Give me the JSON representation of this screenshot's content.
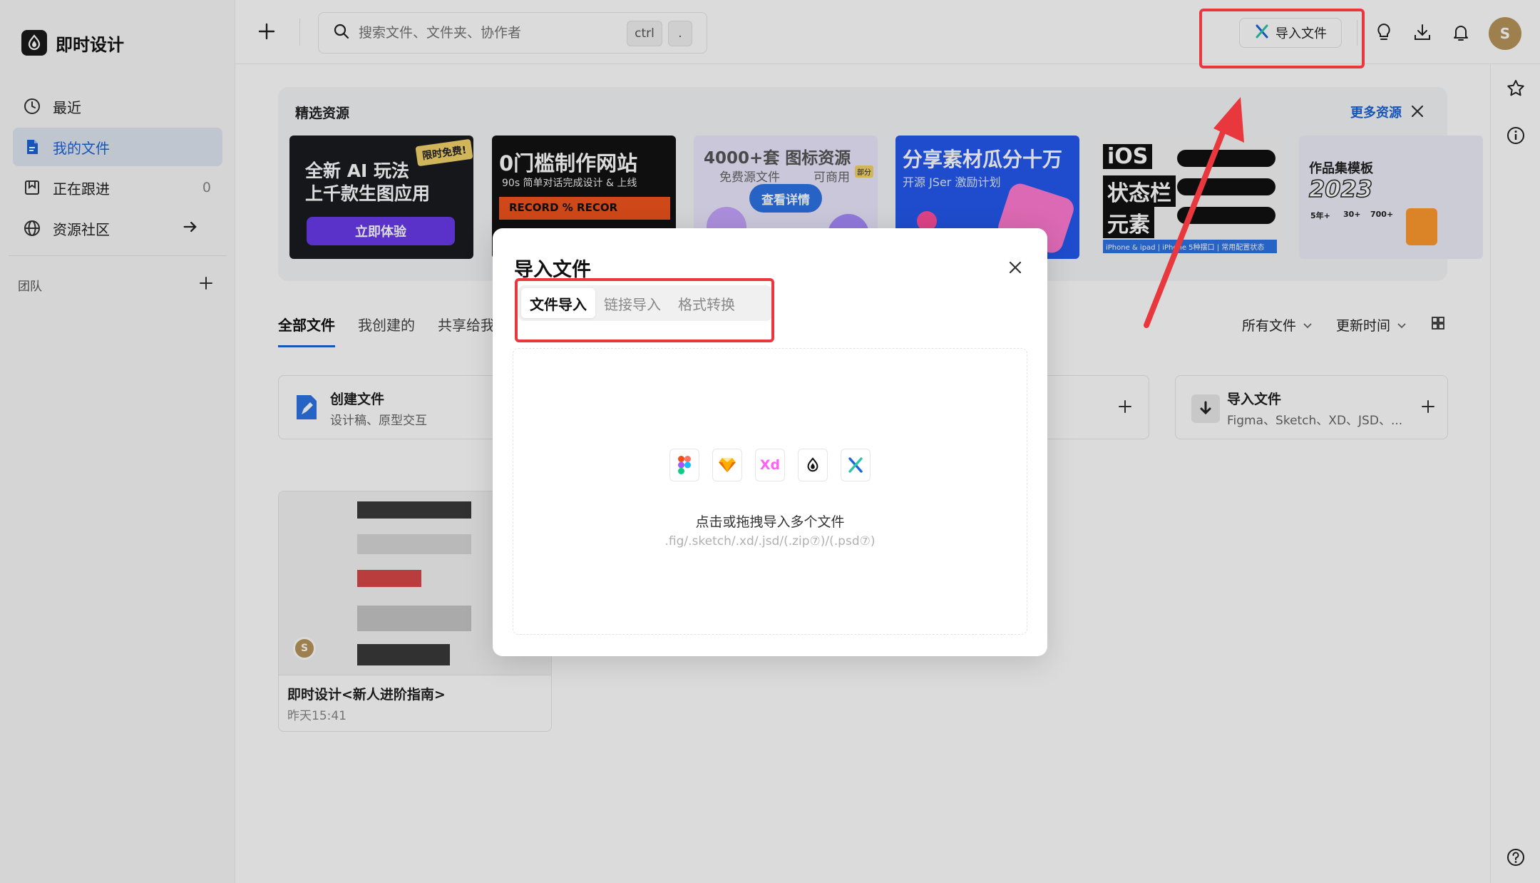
{
  "app": {
    "name": "即时设计"
  },
  "sidebar": {
    "items": [
      {
        "label": "最近",
        "icon": "clock-icon"
      },
      {
        "label": "我的文件",
        "icon": "document-icon",
        "active": true
      },
      {
        "label": "正在跟进",
        "icon": "bookmark-icon",
        "count": "0"
      },
      {
        "label": "资源社区",
        "icon": "globe-icon"
      }
    ],
    "team_label": "团队"
  },
  "search": {
    "placeholder": "搜索文件、文件夹、协作者",
    "shortcut_1": "ctrl",
    "shortcut_2": "."
  },
  "topbar": {
    "import_label": "导入文件",
    "avatar_initial": "S"
  },
  "featured": {
    "title": "精选资源",
    "more_label": "更多资源",
    "cards": [
      {
        "line1": "全新 AI 玩法",
        "line2": "上千款生图应用",
        "badge": "限时免费!",
        "cta": "立即体验"
      },
      {
        "line1": "0门槛制作网站",
        "line2": "90s 简单对话完成设计 & 上线",
        "line3": "RECORD % RECOR"
      },
      {
        "line1": "4000+套 图标资源",
        "line2": "免费源文件",
        "line3": "可商用",
        "badge": "部分",
        "cta": "查看详情"
      },
      {
        "line1": "分享素材瓜分十万",
        "line2": "开源 JSer 激励计划"
      },
      {
        "line1": "iOS",
        "line2": "状态栏",
        "line3": "元素",
        "line4": "iPhone & ipad | iPhone 5种摆口 | 常用配置状态"
      },
      {
        "line1": "作品集模板",
        "line2": "2023",
        "stats": [
          "5年+",
          "30+",
          "700+"
        ]
      }
    ]
  },
  "tabs": {
    "all": "全部文件",
    "created": "我创建的",
    "shared": "共享给我",
    "filter": "所有文件",
    "sort": "更新时间"
  },
  "quick": {
    "create_title": "创建文件",
    "create_sub": "设计稿、原型交互",
    "import_title": "导入文件",
    "import_sub": "Figma、Sketch、XD、JSD、..."
  },
  "file": {
    "name": "即时设计<新人进阶指南>",
    "time": "昨天15:41",
    "avatar_initial": "S"
  },
  "modal": {
    "title": "导入文件",
    "tabs": [
      "文件导入",
      "链接导入",
      "格式转换"
    ],
    "formats": [
      "figma-icon",
      "sketch-icon",
      "xd-icon",
      "jsd-icon",
      "mastergo-icon"
    ],
    "xd_label": "Xd",
    "drop_main": "点击或拖拽导入多个文件",
    "drop_sub": ".fig/.sketch/.xd/.jsd/(.zip⑦)/(.psd⑦)"
  },
  "colors": {
    "accent": "#1d64d8",
    "highlight": "#e8383d",
    "avatar": "#b9955c"
  }
}
